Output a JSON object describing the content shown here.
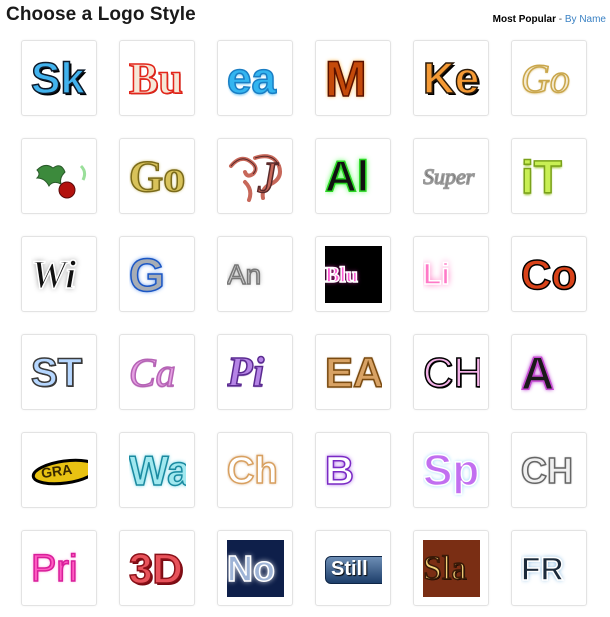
{
  "header": {
    "title": "Choose a Logo Style",
    "sort_current": "Most Popular",
    "sort_separator": " - ",
    "sort_link": "By Name"
  },
  "logos": [
    {
      "name": "sk",
      "text": "Sk",
      "font": "sans",
      "size": 44,
      "weight": "bold",
      "style": "normal",
      "color": "#42b3ee",
      "stroke": "#0d1a2a",
      "shadow": "2px 2px 0 #000"
    },
    {
      "name": "bu",
      "text": "Bu",
      "font": "serif",
      "size": 44,
      "weight": "bold",
      "style": "normal",
      "color": "#f5e7d7",
      "stroke": "#e2261b",
      "shadow": "1px 1px 0 #c0180d"
    },
    {
      "name": "ea",
      "text": "ea",
      "font": "sans",
      "size": 44,
      "weight": "bold",
      "style": "normal",
      "color": "#33b5f0",
      "stroke": "#1a7ec4",
      "shadow": "0 2px 2px #8ad0f5"
    },
    {
      "name": "m",
      "text": "M",
      "font": "sans",
      "size": 50,
      "weight": "bold",
      "style": "normal",
      "color": "#c54a0a",
      "stroke": "#5a1200",
      "shadow": "0 0 4px #ff9a00"
    },
    {
      "name": "ke",
      "text": "Ke",
      "font": "sans",
      "size": 44,
      "weight": "bold",
      "style": "normal",
      "color": "#f59a35",
      "stroke": "#2a1a0a",
      "shadow": "2px 2px 0 #000"
    },
    {
      "name": "go-gold",
      "text": "Go",
      "font": "serif",
      "size": 40,
      "weight": "normal",
      "style": "italic",
      "color": "#f4ead0",
      "stroke": "#c9a64b",
      "shadow": "0 1px 2px #d4b15a"
    },
    {
      "name": "holly",
      "text": "",
      "font": "sans",
      "size": 40,
      "weight": "normal",
      "style": "normal",
      "color": "#3c8a3c",
      "stroke": "#2a5a2a",
      "shadow": "none",
      "icon": "holly"
    },
    {
      "name": "go-metal",
      "text": "Go",
      "font": "serif",
      "size": 44,
      "weight": "bold",
      "style": "normal",
      "color": "#d8c25a",
      "stroke": "#7a6a1a",
      "shadow": "0 0 3px #b09a2a"
    },
    {
      "name": "swirl",
      "text": "J",
      "font": "serif",
      "size": 44,
      "weight": "normal",
      "style": "italic",
      "color": "#c7685a",
      "stroke": "#5a2a2a",
      "shadow": "none",
      "icon": "swirl"
    },
    {
      "name": "al",
      "text": "Al",
      "font": "sans",
      "size": 44,
      "weight": "bold",
      "style": "normal",
      "color": "#111111",
      "stroke": "#2bd624",
      "shadow": "0 0 6px #33ff33"
    },
    {
      "name": "super",
      "text": "Super",
      "font": "serif",
      "size": 22,
      "weight": "normal",
      "style": "italic",
      "color": "#555555",
      "stroke": "#999",
      "shadow": "none"
    },
    {
      "name": "it",
      "text": "iT",
      "font": "sans",
      "size": 46,
      "weight": "bold",
      "style": "normal",
      "color": "#c8ef54",
      "stroke": "#7aa11a",
      "shadow": "0 2px 2px #9bc432"
    },
    {
      "name": "wi",
      "text": "Wi",
      "font": "serif",
      "size": 40,
      "weight": "bold",
      "style": "italic",
      "color": "#111111",
      "stroke": "#fff",
      "shadow": "0 0 6px #888"
    },
    {
      "name": "g-steel",
      "text": "G",
      "font": "sans",
      "size": 46,
      "weight": "bold",
      "style": "normal",
      "color": "#a7adb5",
      "stroke": "#1b56c4",
      "shadow": "0 0 4px #3a7de8"
    },
    {
      "name": "an",
      "text": "An",
      "font": "sans",
      "size": 28,
      "weight": "normal",
      "style": "normal",
      "color": "#d0d0d0",
      "stroke": "#777",
      "shadow": "0 0 5px #999"
    },
    {
      "name": "blu",
      "text": "Blu",
      "font": "serif",
      "size": 22,
      "weight": "bold",
      "style": "normal",
      "color": "#ff5ad4",
      "stroke": "#fff",
      "shadow": "0 0 4px #ff33cc",
      "bg": "#000000"
    },
    {
      "name": "li",
      "text": "Li",
      "font": "sans",
      "size": 30,
      "weight": "bold",
      "style": "normal",
      "color": "#ff79c7",
      "stroke": "#fff",
      "shadow": "0 0 7px #ff57b3"
    },
    {
      "name": "co",
      "text": "Co",
      "font": "sans",
      "size": 42,
      "weight": "bold",
      "style": "normal",
      "color": "#d9431a",
      "stroke": "#000",
      "shadow": "0 0 0 #000"
    },
    {
      "name": "st",
      "text": "ST",
      "font": "sans",
      "size": 40,
      "weight": "bold",
      "style": "normal",
      "color": "#b6d7ff",
      "stroke": "#3a3a3a",
      "shadow": "1px 1px 0 #333"
    },
    {
      "name": "ca",
      "text": "Ca",
      "font": "serif",
      "size": 40,
      "weight": "normal",
      "style": "italic",
      "color": "#e5a0e2",
      "stroke": "#b563b5",
      "shadow": "0 1px 1px #c085c0"
    },
    {
      "name": "pi",
      "text": "Pi",
      "font": "serif",
      "size": 42,
      "weight": "bold",
      "style": "italic",
      "color": "#b584e6",
      "stroke": "#5a2a90",
      "shadow": "0 1px 1px #7a4ab0"
    },
    {
      "name": "ea-wood",
      "text": "EA",
      "font": "sans",
      "size": 42,
      "weight": "bold",
      "style": "normal",
      "color": "#d8a264",
      "stroke": "#7a4a10",
      "shadow": "0 0 2px #9a6a2a"
    },
    {
      "name": "ch-pink",
      "text": "CH",
      "font": "sans",
      "size": 42,
      "weight": "normal",
      "style": "normal",
      "color": "#f4b2e8",
      "stroke": "#000",
      "shadow": "1px 1px 0 #000"
    },
    {
      "name": "a-neon",
      "text": "A",
      "font": "sans",
      "size": 46,
      "weight": "bold",
      "style": "normal",
      "color": "#1a1a1a",
      "stroke": "#c64ad2",
      "shadow": "0 0 4px #a300c4"
    },
    {
      "name": "gra",
      "text": "GRA",
      "font": "sans",
      "size": 14,
      "weight": "bold",
      "style": "normal",
      "color": "#d8b200",
      "stroke": "#000",
      "shadow": "none",
      "icon": "badge"
    },
    {
      "name": "wa",
      "text": "Wa",
      "font": "sans",
      "size": 42,
      "weight": "bold",
      "style": "normal",
      "color": "#a0e8ef",
      "stroke": "#1a8aa0",
      "shadow": "0 0 4px #33c0d8"
    },
    {
      "name": "ch-glass",
      "text": "Ch",
      "font": "sans",
      "size": 38,
      "weight": "bold",
      "style": "normal",
      "color": "#ffffff",
      "stroke": "#d8a060",
      "shadow": "0 0 3px #c88a4a"
    },
    {
      "name": "b-purple",
      "text": "B",
      "font": "sans",
      "size": 40,
      "weight": "bold",
      "style": "normal",
      "color": "#ffffff",
      "stroke": "#7a2ac4",
      "shadow": "0 0 5px #9a4ae4"
    },
    {
      "name": "sp",
      "text": "Sp",
      "font": "sans",
      "size": 44,
      "weight": "bold",
      "style": "normal",
      "color": "#c26ff0",
      "stroke": "#fff",
      "shadow": "0 0 4px #7acdf5"
    },
    {
      "name": "ch-drip",
      "text": "CH",
      "font": "sans",
      "size": 36,
      "weight": "bold",
      "style": "normal",
      "color": "#f0f0f0",
      "stroke": "#666",
      "shadow": "0 0 2px #777"
    },
    {
      "name": "pri",
      "text": "Pri",
      "font": "sans",
      "size": 38,
      "weight": "normal",
      "style": "normal",
      "color": "#ff5cc2",
      "stroke": "#d81e9a",
      "shadow": "0 0 3px #ff7ad0"
    },
    {
      "name": "3d",
      "text": "3D",
      "font": "sans",
      "size": 42,
      "weight": "bold",
      "style": "normal",
      "color": "#e8535b",
      "stroke": "#8a1018",
      "shadow": "2px 2px 0 #7a0a12"
    },
    {
      "name": "no",
      "text": "No",
      "font": "sans",
      "size": 36,
      "weight": "bold",
      "style": "normal",
      "color": "#9fb4d6",
      "stroke": "#fff",
      "shadow": "0 0 6px #fff",
      "bg": "#0e1f4a"
    },
    {
      "name": "still",
      "text": "Still",
      "font": "sans",
      "size": 20,
      "weight": "bold",
      "style": "normal",
      "color": "#ffffff",
      "stroke": "#1a3c6a",
      "shadow": "1px 1px 1px #000",
      "icon": "button"
    },
    {
      "name": "sla",
      "text": "Sla",
      "font": "serif",
      "size": 34,
      "weight": "normal",
      "style": "normal",
      "color": "#f2d27a",
      "stroke": "#3a1a08",
      "shadow": "1px 1px 0 #000",
      "bg": "#7a2e14"
    },
    {
      "name": "fr",
      "text": "FR",
      "font": "sans",
      "size": 32,
      "weight": "bold",
      "style": "normal",
      "color": "#1c2a3a",
      "stroke": "#ffffff",
      "shadow": "0 0 5px #6aa8d8"
    }
  ]
}
